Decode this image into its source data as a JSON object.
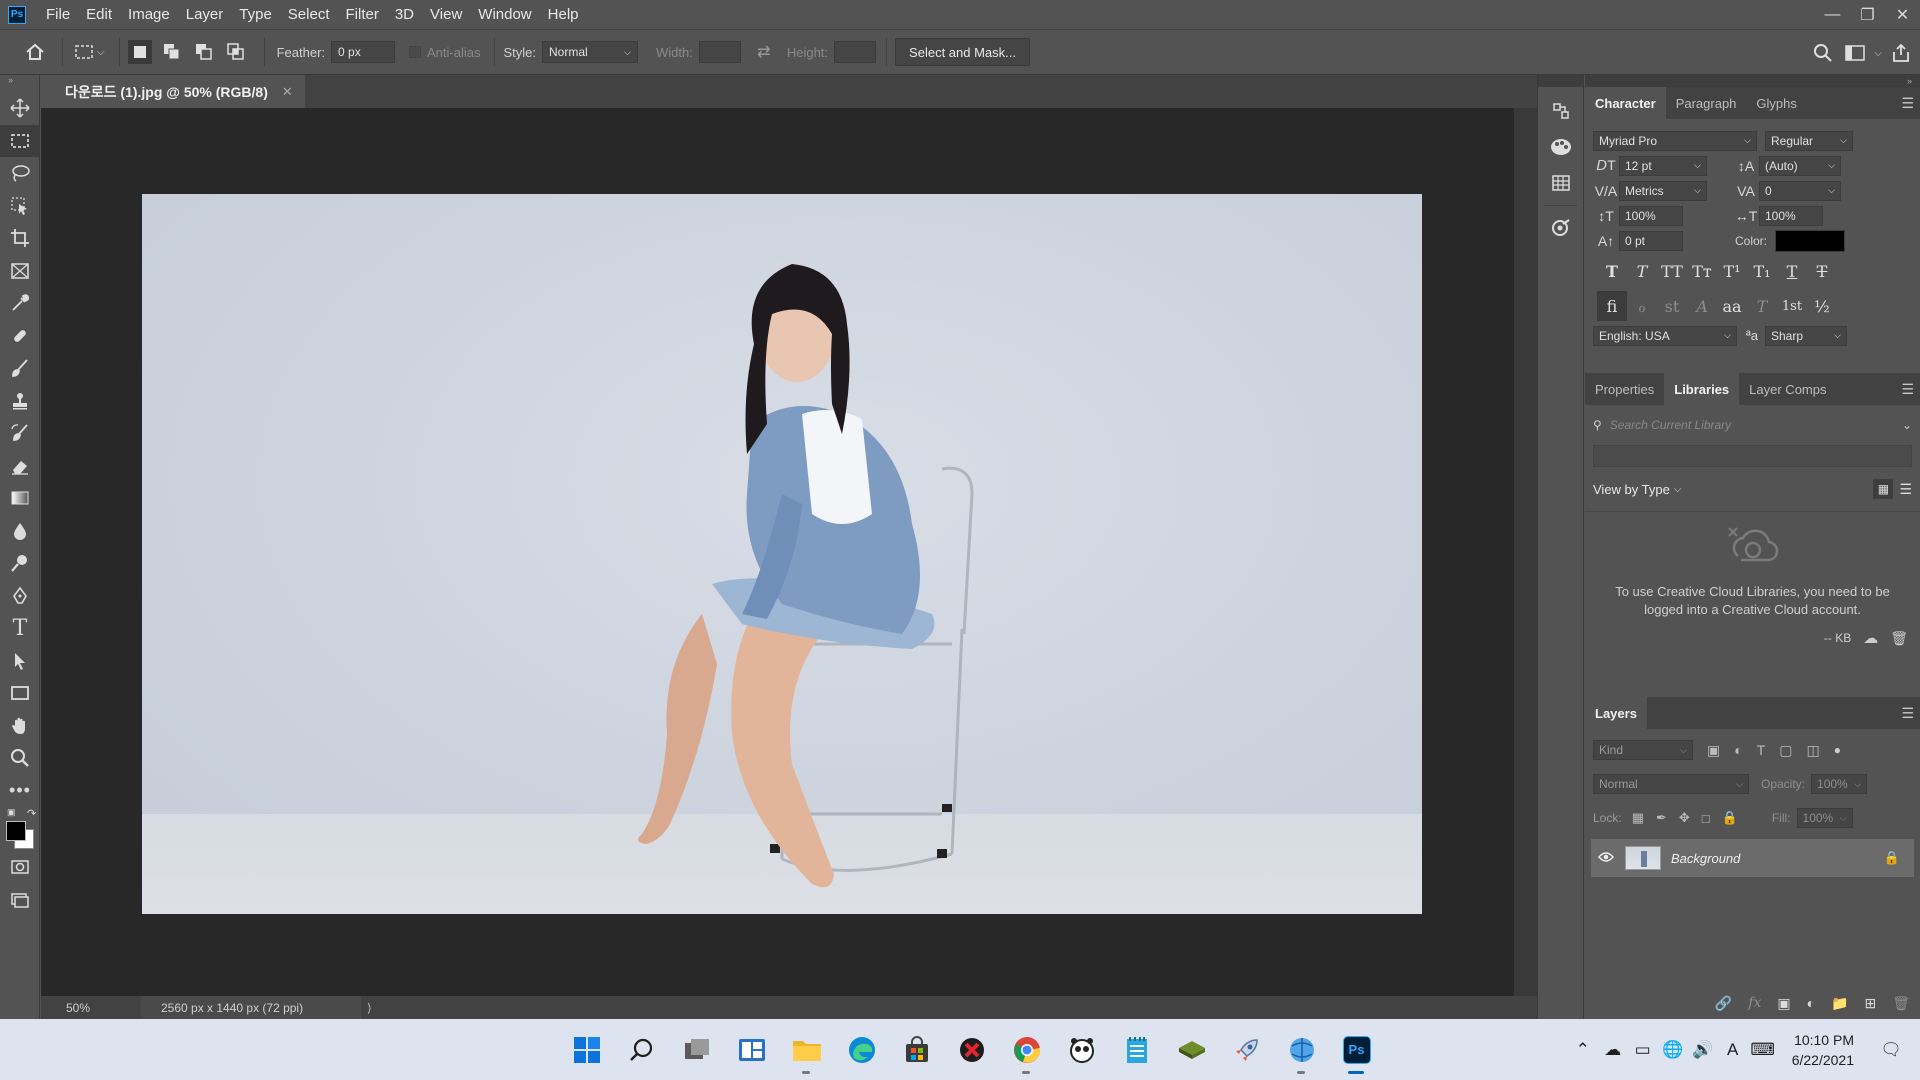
{
  "menubar": {
    "logo": "Ps",
    "items": [
      "File",
      "Edit",
      "Image",
      "Layer",
      "Type",
      "Select",
      "Filter",
      "3D",
      "View",
      "Window",
      "Help"
    ]
  },
  "options": {
    "feather_label": "Feather:",
    "feather_value": "0 px",
    "antialias_label": "Anti-alias",
    "style_label": "Style:",
    "style_value": "Normal",
    "width_label": "Width:",
    "height_label": "Height:",
    "select_mask_label": "Select and Mask..."
  },
  "document": {
    "tab_title": "다운로드 (1).jpg @ 50% (RGB/8)",
    "zoom": "50%",
    "dimensions": "2560 px x 1440 px (72 ppi)"
  },
  "character": {
    "tabs": [
      "Character",
      "Paragraph",
      "Glyphs"
    ],
    "font_family": "Myriad Pro",
    "font_style": "Regular",
    "font_size": "12 pt",
    "leading": "(Auto)",
    "kerning": "Metrics",
    "tracking": "0",
    "vertical_scale": "100%",
    "horizontal_scale": "100%",
    "baseline_shift": "0 pt",
    "color_label": "Color:",
    "color_value": "#000000",
    "language": "English: USA",
    "aa_label": "ªa",
    "antialias": "Sharp",
    "type_buttons": [
      "T",
      "T",
      "TT",
      "Tт",
      "T¹",
      "T₁",
      "T",
      "T"
    ],
    "glyph_buttons": [
      "fi",
      "ℴ",
      "st",
      "A",
      "aa",
      "T",
      "1st",
      "½"
    ]
  },
  "libraries": {
    "tabs": [
      "Properties",
      "Libraries",
      "Layer Comps"
    ],
    "search_placeholder": "Search Current Library",
    "view_by": "View by Type",
    "message": "To use Creative Cloud Libraries, you need to be logged into a Creative Cloud account.",
    "size": "-- KB"
  },
  "layers": {
    "tab": "Layers",
    "kind_placeholder": "Kind",
    "blend_mode": "Normal",
    "opacity_label": "Opacity:",
    "opacity_value": "100%",
    "lock_label": "Lock:",
    "fill_label": "Fill:",
    "fill_value": "100%",
    "items": [
      {
        "name": "Background",
        "visible": true,
        "locked": true
      }
    ]
  },
  "taskbar": {
    "time": "10:10 PM",
    "date": "6/22/2021",
    "ime": "A",
    "ps_label": "Ps"
  }
}
